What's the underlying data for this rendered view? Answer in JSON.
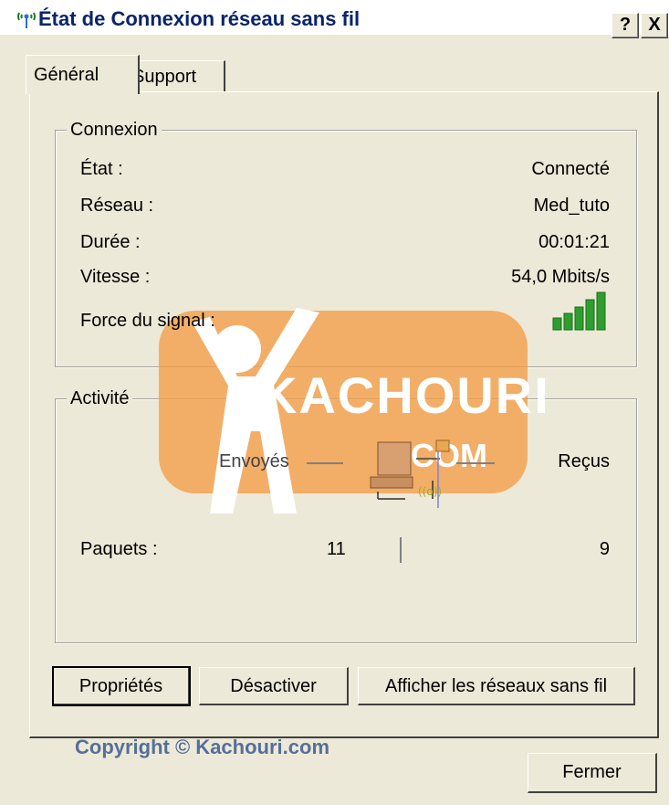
{
  "window": {
    "title": "État de Connexion réseau sans fil",
    "help_label": "?",
    "close_label": "X"
  },
  "tabs": [
    {
      "label": "Général",
      "active": true
    },
    {
      "label": "Support",
      "active": false
    }
  ],
  "connexion": {
    "title": "Connexion",
    "rows": [
      {
        "label": "État :",
        "value": "Connecté"
      },
      {
        "label": "Réseau :",
        "value": "Med_tuto"
      },
      {
        "label": "Durée :",
        "value": "00:01:21"
      },
      {
        "label": "Vitesse :",
        "value": "54,0 Mbits/s"
      }
    ],
    "signal_label": "Force du signal :",
    "signal_bars": 5
  },
  "activite": {
    "title": "Activité",
    "sent_label": "Envoyés",
    "received_label": "Reçus",
    "packets_label": "Paquets :",
    "packets_sent": "11",
    "packets_received": "9"
  },
  "buttons": {
    "properties": "Propriétés",
    "disable": "Désactiver",
    "show_networks": "Afficher les réseaux sans fil",
    "close": "Fermer"
  },
  "watermark": {
    "brand": "KACHOURI",
    "domain": ".COM",
    "copyright": "Copyright © Kachouri.com"
  },
  "colors": {
    "dialog_bg": "#ece9d8",
    "title_text": "#0a246a",
    "signal_green": "#2e9e2e",
    "watermark_orange": "#f49e46"
  }
}
